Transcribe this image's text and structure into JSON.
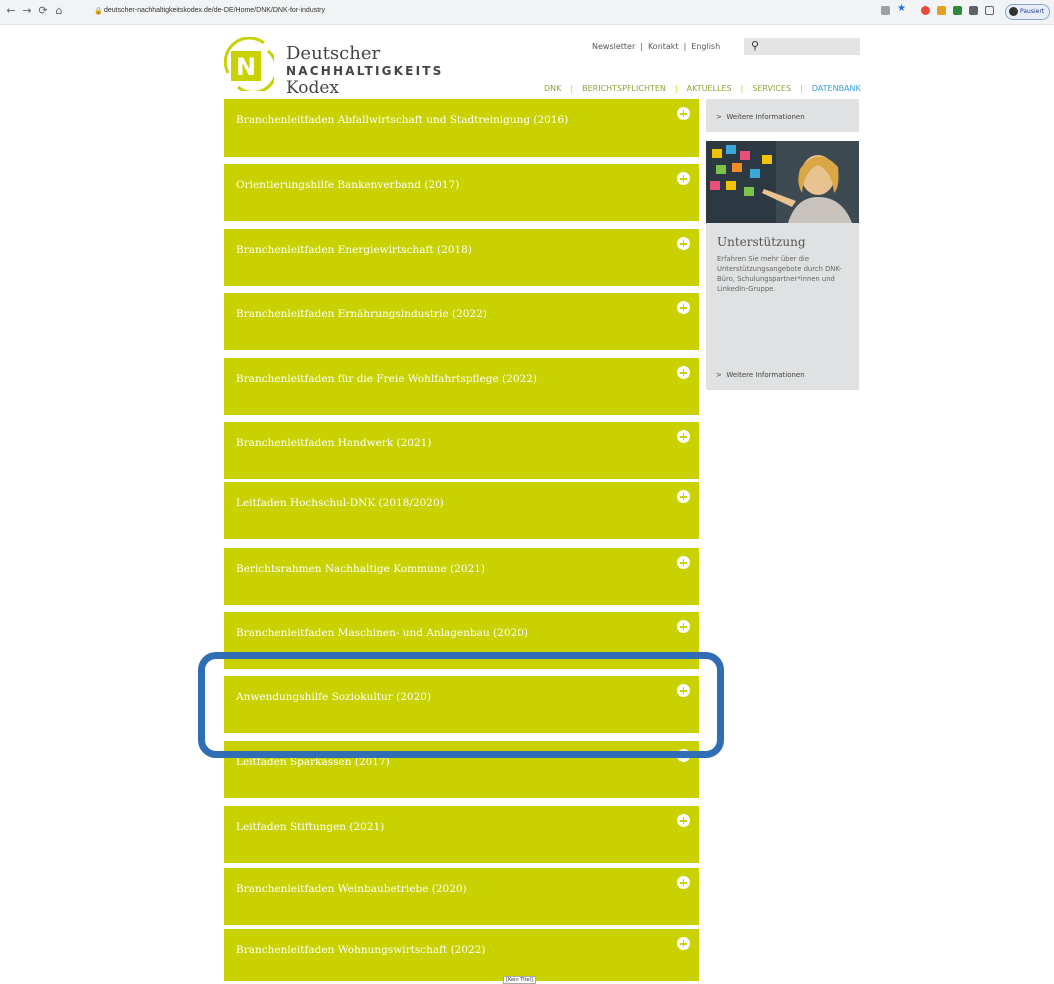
{
  "browser": {
    "url": "deutscher-nachhaltigkeitskodex.de/de-DE/Home/DNK/DNK-for-industry",
    "profile_label": "Pausiert"
  },
  "site": {
    "logo": {
      "line1": "Deutscher",
      "line2": "NACHHALTIGKEITS",
      "line3": "Kodex",
      "letter": "N"
    },
    "top_nav": [
      "Newsletter",
      "Kontakt",
      "English"
    ],
    "main_nav": [
      "DNK",
      "BERICHTSPFLICHTEN",
      "AKTUELLES",
      "SERVICES",
      "DATENBANK"
    ],
    "colors": {
      "accent": "#c9d200",
      "sidebar_bg": "#dfe1e2",
      "highlight": "#2f6db4",
      "datenbank": "#3a9ed3"
    }
  },
  "accordion": [
    "Branchenleitfaden Abfallwirtschaft und Stadtreinigung (2016)",
    "Orientierungshilfe Bankenverband (2017)",
    "Branchenleitfaden Energiewirtschaft (2018)",
    "Branchenleitfaden Ernährungsindustrie (2022)",
    "Branchenleitfaden für die Freie Wohlfahrtspflege (2022)",
    "Branchenleitfaden Handwerk (2021)",
    "Leitfaden Hochschul-DNK (2018/2020)",
    "Berichtsrahmen Nachhaltige Kommune (2021)",
    "Branchenleitfaden Maschinen- und Anlagenbau (2020)",
    "Anwendungshilfe Soziokultur (2020)",
    "Leitfaden Sparkassen (2017)",
    "Leitfaden Stiftungen (2021)",
    "Branchenleitfaden Weinbaubetriebe (2020)",
    "Branchenleitfaden Wohnungswirtschaft (2022)"
  ],
  "sidebar": {
    "top_link": "Weitere Informationen",
    "title": "Unterstützung",
    "description": "Erfahren Sie mehr über die Unterstützungsangebote durch DNK-Büro, Schulungspartner*innen und LinkedIn-Gruppe.",
    "bottom_link": "Weitere Informationen"
  },
  "tooltip": "[Kein Titel]"
}
